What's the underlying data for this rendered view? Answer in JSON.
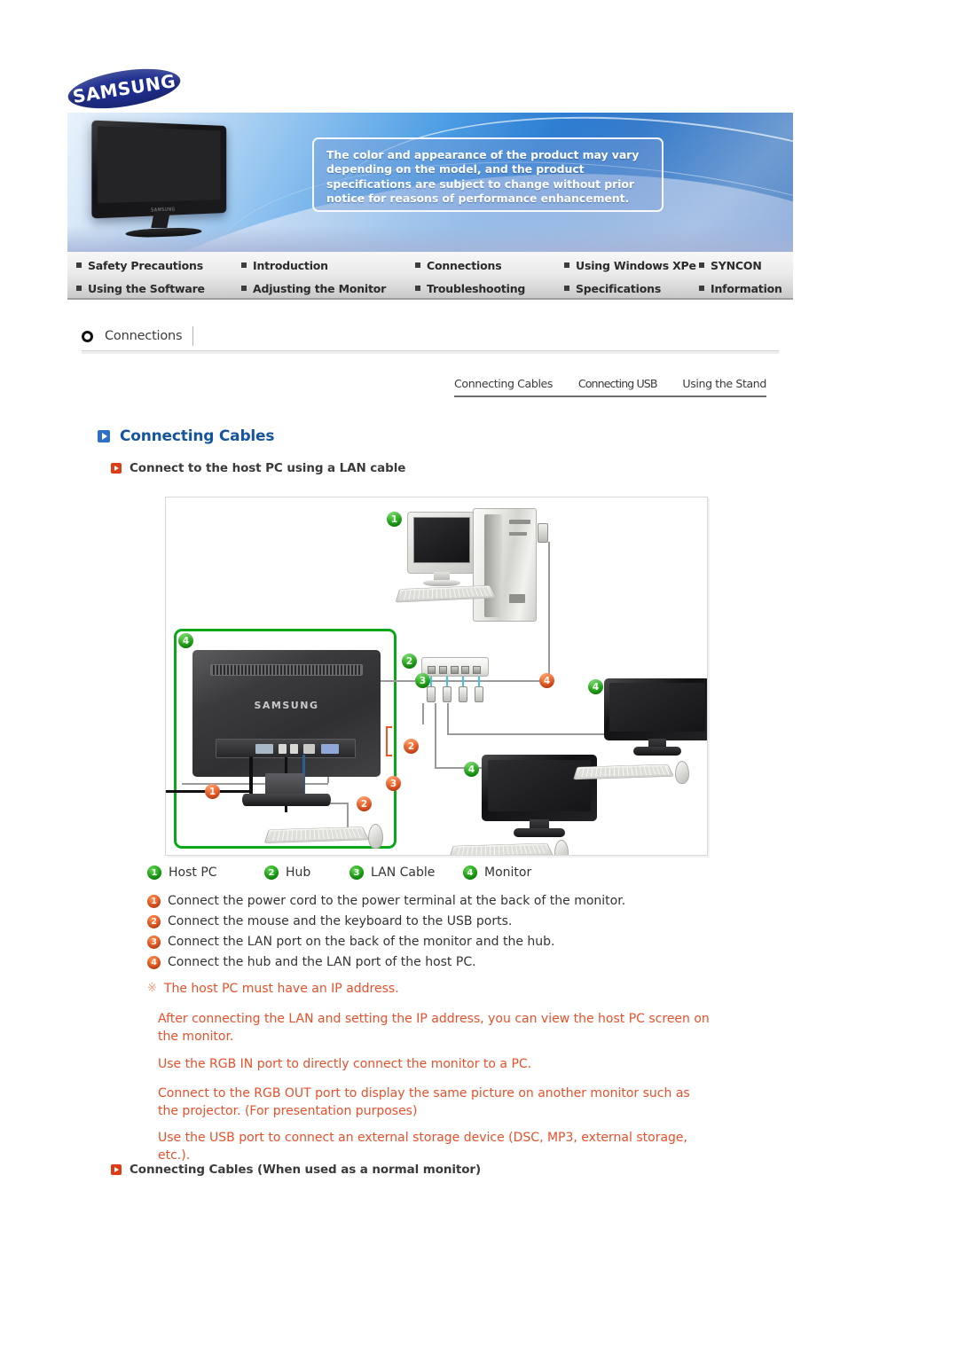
{
  "brand": {
    "logo_text": "SAMSUNG",
    "logo_color": "#1f2f8f"
  },
  "banner": {
    "notice": "The color and appearance of the product may vary depending on the model, and the product specifications are subject to change without prior notice for reasons of performance enhancement.",
    "monitor_brand_label": "SAMSUNG"
  },
  "main_nav": {
    "row1": [
      {
        "label": "Safety Precautions"
      },
      {
        "label": "Introduction"
      },
      {
        "label": "Connections"
      },
      {
        "label": "Using Windows XPe"
      },
      {
        "label": "SYNCON"
      }
    ],
    "row2": [
      {
        "label": "Using the Software"
      },
      {
        "label": "Adjusting the Monitor"
      },
      {
        "label": "Troubleshooting"
      },
      {
        "label": "Specifications"
      },
      {
        "label": "Information"
      }
    ]
  },
  "breadcrumb": {
    "label": "Connections"
  },
  "sub_tabs": [
    {
      "label": "Connecting Cables"
    },
    {
      "label": "Connecting USB"
    },
    {
      "label": "Using the Stand"
    }
  ],
  "headings": {
    "h1": "Connecting Cables",
    "h1_color": "#14559e",
    "h2": "Connect to the host PC using a LAN cable",
    "h2_bottom": "Connecting Cables (When used as a normal monitor)"
  },
  "diagram": {
    "callouts": [
      {
        "n": "1",
        "color": "green"
      },
      {
        "n": "2",
        "color": "green"
      },
      {
        "n": "3",
        "color": "green"
      },
      {
        "n": "4",
        "color": "green"
      },
      {
        "n": "4",
        "color": "green"
      },
      {
        "n": "4",
        "color": "green"
      },
      {
        "n": "4",
        "color": "orange"
      },
      {
        "n": "1",
        "color": "orange"
      },
      {
        "n": "2",
        "color": "orange"
      },
      {
        "n": "2",
        "color": "orange"
      },
      {
        "n": "3",
        "color": "orange"
      }
    ],
    "monitor_brand": "SAMSUNG",
    "highlight_color": "#0aa818"
  },
  "legend": [
    {
      "n": "1",
      "label": "Host PC"
    },
    {
      "n": "2",
      "label": "Hub"
    },
    {
      "n": "3",
      "label": "LAN Cable"
    },
    {
      "n": "4",
      "label": "Monitor"
    }
  ],
  "steps": [
    {
      "n": "1",
      "text": "Connect the power cord to the power terminal at the back of the monitor."
    },
    {
      "n": "2",
      "text": "Connect the mouse and the keyboard to the USB ports."
    },
    {
      "n": "3",
      "text": "Connect the LAN port on the back of the monitor and the hub."
    },
    {
      "n": "4",
      "text": "Connect the hub and the LAN port of the host PC."
    }
  ],
  "notes": {
    "star_mark": "※",
    "star_text": "The host PC must have an IP address.",
    "p1": "After connecting the LAN and setting the IP address, you can view the host PC screen on the monitor.",
    "p2": "Use the RGB IN port to directly connect the monitor to a PC.",
    "p3": "Connect to the RGB OUT port to display the same picture on another monitor such as the projector. (For presentation purposes)",
    "p4": "Use the USB port to connect an external storage device (DSC, MP3, external storage, etc.).",
    "color": "#e8502a"
  }
}
